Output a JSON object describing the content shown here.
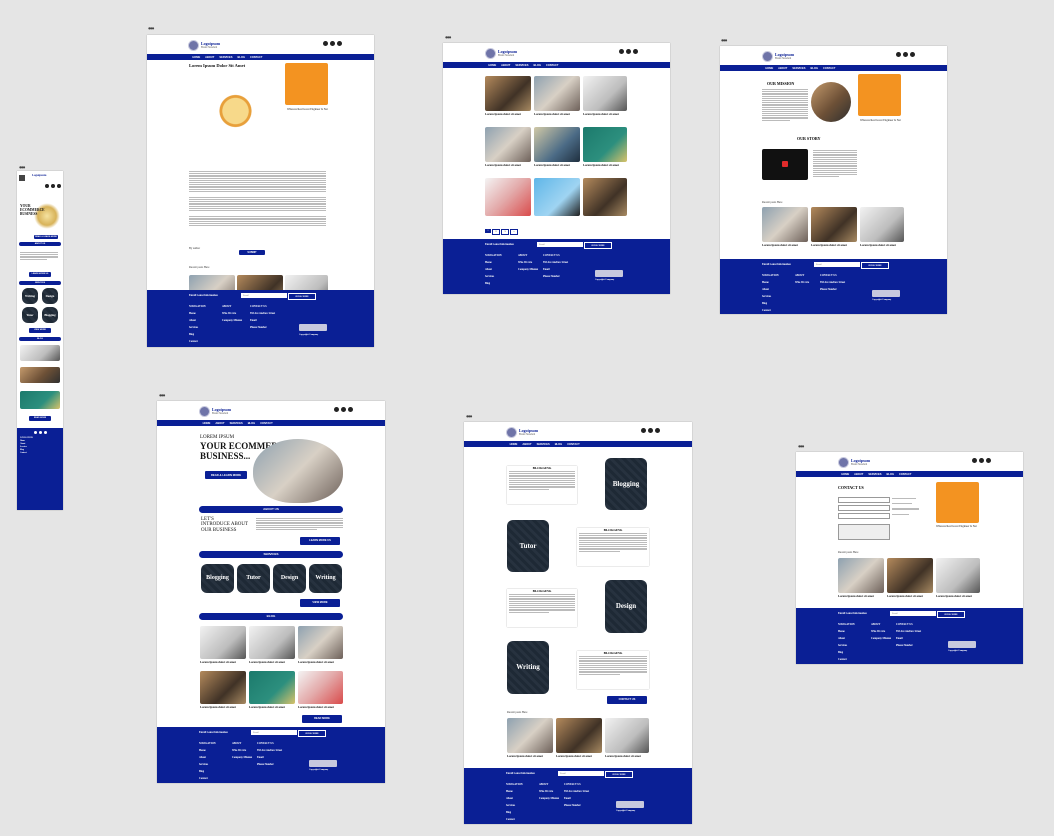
{
  "site": {
    "brand_name": "Logoipsum",
    "brand_tag": "Brand Standard",
    "nav": [
      "HOME",
      "ABOUT",
      "SERVICES",
      "BLOG",
      "CONTACT"
    ],
    "footer": {
      "newsletter": "Enroll Latest Information",
      "email_placeholder": "Email",
      "subscribe": "SUBSCRIBE",
      "col1_head": "NAVIGATION",
      "col1": [
        "Home",
        "About",
        "Services",
        "Blog",
        "Contact"
      ],
      "col2_head": "ABOUT",
      "col2": [
        "Who We Are",
        "Company Mission"
      ],
      "col3_head": "CONTACT US",
      "col3": [
        "555 Ave Andrew Street",
        "Email",
        "Phone Number"
      ],
      "copyright": "Copyright Company"
    }
  },
  "frames": {
    "blog_post": {
      "title": "Lorem Ipsum Dolor Sit Amet",
      "sidebar_caption": "Whereas Real Great Engineer Is Not",
      "author_label": "By author",
      "submit": "SUBMIT",
      "related_label": "Recent posts Here",
      "post_title": "Lorem Ipsum dolor sit amet"
    },
    "blog_grid": {
      "post_title": "Lorem Ipsum dolor sit amet",
      "pages": [
        "1",
        "2",
        "3",
        "»"
      ]
    },
    "about": {
      "mission_heading": "OUR MISSION",
      "story_heading": "OUR STORY",
      "sidebar_caption": "Whereas Real Great Engineer Is Not",
      "related_label": "Recent posts Here",
      "post_title": "Lorem Ipsum dolor sit amet"
    },
    "home": {
      "hero_kicker": "LOREM IPSUM",
      "hero_title_1": "YOUR ECOMMERCE",
      "hero_title_2": "BUSINESS...",
      "hero_btn": "READ & LEARN MORE",
      "section_about": "ABOUT US",
      "intro_1": "LET'S",
      "intro_2": "INTRODUCE ABOUT",
      "intro_3": "OUR BUSINESS",
      "learn_more": "LEARN MORE US",
      "section_services": "SERVICES",
      "services": [
        "Blogging",
        "Tutor",
        "Design",
        "Writing"
      ],
      "view_more": "VIEW MORE",
      "section_blog": "BLOG",
      "post_title": "Lorem Ipsum dolor sit amet",
      "read_more": "READ MORE"
    },
    "services": {
      "block_heading": "BLOGGING",
      "items": [
        "Blogging",
        "Tutor",
        "Design",
        "Writing"
      ],
      "contact_btn": "CONTACT US",
      "related_label": "Recent posts Here",
      "post_title": "Lorem Ipsum dolor sit amet"
    },
    "contact": {
      "heading": "CONTACT US",
      "sidebar_caption": "Whereas Real Great Engineer Is Not",
      "related_label": "Recent posts Here",
      "post_title": "Lorem Ipsum dolor sit amet"
    },
    "mobile": {
      "hero_1": "YOUR",
      "hero_2": "ECOMMERCE",
      "hero_3": "BUSINESS",
      "services": [
        "Writing",
        "Design",
        "Tutor",
        "Blogging"
      ],
      "btn_about": "ABOUT US",
      "btn_services": "SERVICES",
      "btn_blog": "BLOG",
      "btn_read": "READ MORE",
      "btn_view": "VIEW MORE"
    }
  }
}
